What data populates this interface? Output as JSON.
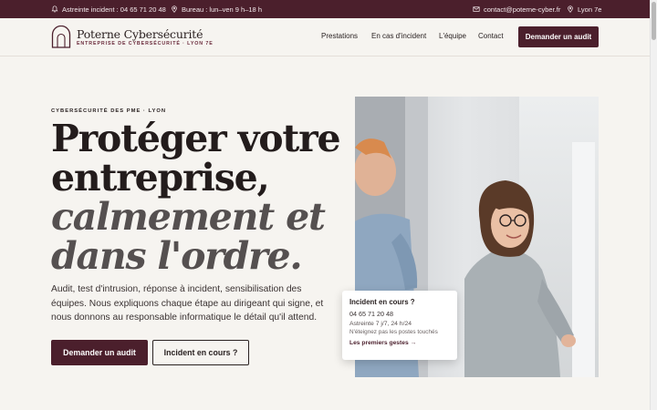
{
  "topbar": {
    "hotline": "Astreinte incident : 04 65 71 20 48",
    "hours": "Bureau : lun–ven 9 h–18 h",
    "email": "contact@poterne-cyber.fr",
    "city": "Lyon 7e"
  },
  "brand": {
    "name": "Poterne Cybersécurité",
    "tagline": "ENTREPRISE DE CYBERSÉCURITÉ · LYON 7E"
  },
  "nav": {
    "items": [
      "Prestations",
      "En cas d'incident",
      "L'équipe",
      "Contact"
    ],
    "cta": "Demander un audit"
  },
  "hero": {
    "eyebrow": "CYBERSÉCURITÉ DES PME · LYON",
    "title_line1": "Protéger votre",
    "title_line2": "entreprise,",
    "title_line3": "calmement et",
    "title_line4": "dans l'ordre.",
    "lead": "Audit, test d'intrusion, réponse à incident, sensibilisation des équipes. Nous expliquons chaque étape au dirigeant qui signe, et nous donnons au responsable informatique le détail qu'il attend.",
    "primary_cta": "Demander un audit",
    "secondary_cta": "Incident en cours ?"
  },
  "incident_card": {
    "title": "Incident en cours ?",
    "phone": "04 65 71 20 48",
    "availability": "Astreinte 7 j/7, 24 h/24",
    "advice": "N'éteignez pas les postes touchés",
    "link": "Les premiers gestes →"
  },
  "colors": {
    "brand": "#4b1f2c",
    "background": "#f6f4f0",
    "text": "#2a2222"
  }
}
